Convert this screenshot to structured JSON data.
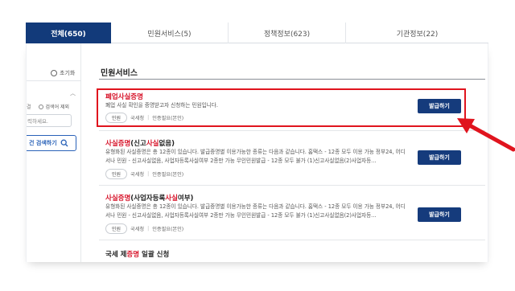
{
  "tabs": [
    {
      "label": "전체(650)",
      "active": true
    },
    {
      "label": "민원서비스(5)",
      "active": false
    },
    {
      "label": "정책정보(623)",
      "active": false
    },
    {
      "label": "기관정보(22)",
      "active": false
    }
  ],
  "filter": {
    "reset_label": "초기화",
    "radio_label_partial": "결",
    "radio_exclude_label": "검색어 제외",
    "keyword_placeholder": "력하세요.",
    "search_button_label": "건 검색하기"
  },
  "section": {
    "title": "민원서비스"
  },
  "items": [
    {
      "title_pre": "",
      "title_hl": "폐업사실증명",
      "title_post": "",
      "desc": "폐업 사실 확인을 증명받고자 신청하는 민원입니다.",
      "type_chip": "민원",
      "org": "국세청",
      "auth": "인증필요(본인)",
      "button": "발급하기",
      "highlighted": true
    },
    {
      "title_pre": "",
      "title_hl": "사실증명",
      "title_mid": "(신고",
      "title_hl2": "사실",
      "title_post": "없음)",
      "desc": "유형화된 사실증명은 총 12종이 있습니다. 발급증명별 이용가능한 종류는 다음과 같습니다. 홈택스 - 12종 모두 이용 가능 정부24, 어디서나 민원 - 신고사실없음, 사업자등록사실여부 2종만 가능 무인민원발급 - 12종 모두 불가 (1)신고사실없음(2)사업자등...",
      "type_chip": "민원",
      "org": "국세청",
      "auth": "인증필요(본인)",
      "button": "발급하기"
    },
    {
      "title_pre": "",
      "title_hl": "사실증명",
      "title_mid": "(사업자등록",
      "title_hl2": "사실",
      "title_post": "여부)",
      "desc": "유형화된 사실증명은 총 12종이 있습니다. 발급증명별 이용가능한 종류는 다음과 같습니다. 홈택스 - 12종 모두 이용 가능 정부24, 어디서나 민원 - 신고사실없음, 사업자등록사실여부 2종만 가능 무인민원발급 - 12종 모두 불가 (1)신고사실없음(2)사업자등...",
      "type_chip": "민원",
      "org": "국세청",
      "auth": "인증필요(본인)",
      "button": "발급하기"
    },
    {
      "title_pre": "국세 제",
      "title_hl": "증명",
      "title_post": " 일괄 신청"
    }
  ],
  "colors": {
    "accent": "#153b7c",
    "highlight_text": "#d7142a",
    "annotation": "#e0141e"
  }
}
